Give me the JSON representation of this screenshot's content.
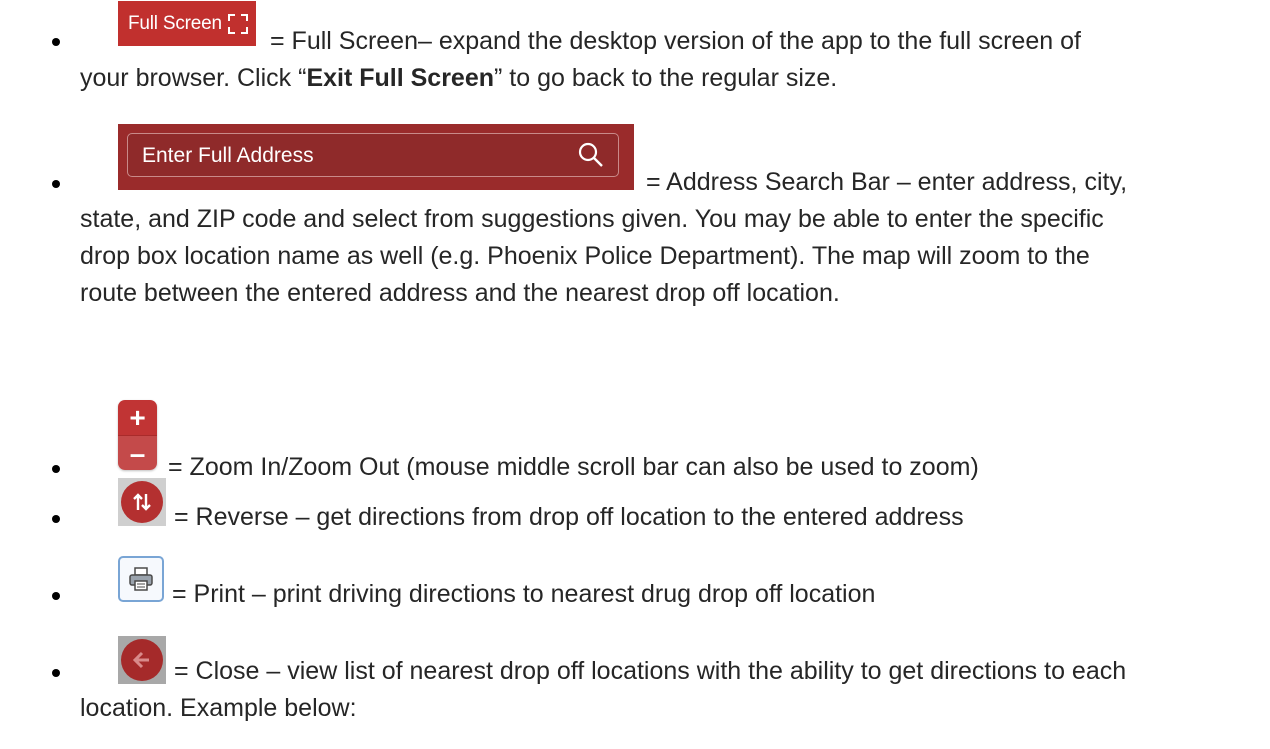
{
  "full_screen": {
    "button_label": "Full Screen",
    "description_line1": "= Full Screen– expand the desktop version of the app to the full screen of",
    "description_line2_pre": "your browser. Click “",
    "description_line2_bold": "Exit Full Screen",
    "description_line2_post": "” to go back to the regular size."
  },
  "address_search": {
    "placeholder": "Enter Full Address",
    "description_line1": "= Address Search Bar – enter address, city,",
    "description_line2": "state, and ZIP code and select from suggestions given. You may be able to enter the specific",
    "description_line3": "drop box location name as well (e.g. Phoenix Police Department). The map will zoom to the",
    "description_line4": "route between the entered address and the nearest drop off location."
  },
  "zoom": {
    "plus": "+",
    "minus": "–",
    "description": "= Zoom In/Zoom Out (mouse middle scroll bar can also be used to zoom)"
  },
  "reverse": {
    "description": "= Reverse – get directions from drop off location to the entered address"
  },
  "print": {
    "description": "= Print – print driving directions to nearest drug drop off location"
  },
  "close": {
    "description_line1": "= Close – view list of nearest drop off locations with the ability to get directions to each",
    "description_line2": "location. Example below:"
  },
  "colors": {
    "accent_red": "#c1302e",
    "search_bg": "#9a2b2b",
    "print_border": "#79a5d5"
  }
}
